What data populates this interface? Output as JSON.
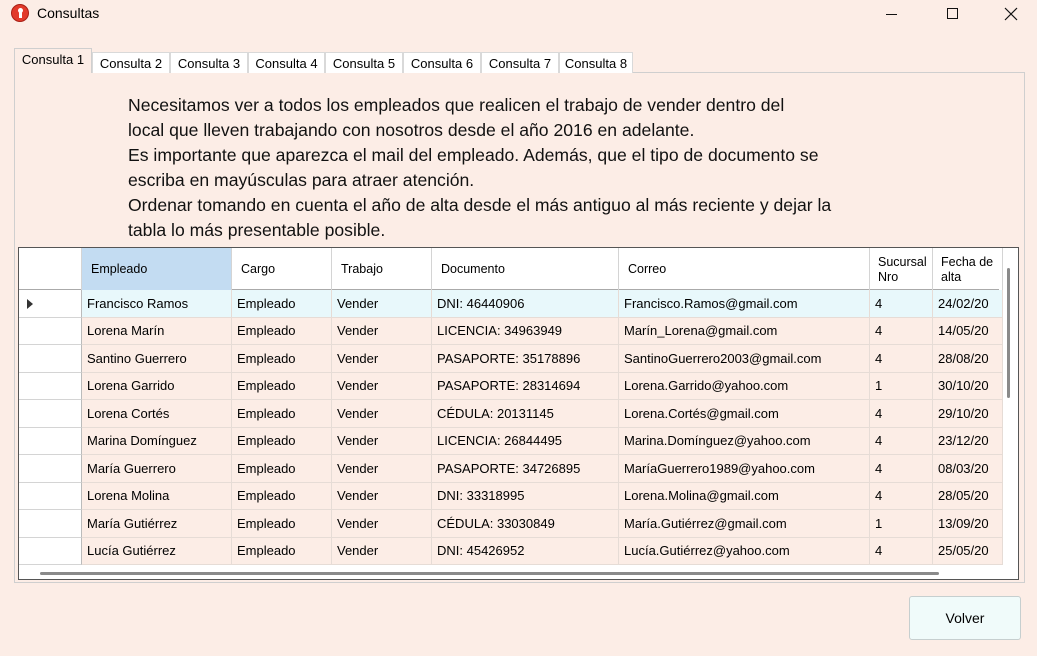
{
  "window": {
    "title": "Consultas",
    "icon": "app-record-icon"
  },
  "tabs": [
    "Consulta 1",
    "Consulta 2",
    "Consulta 3",
    "Consulta 4",
    "Consulta 5",
    "Consulta 6",
    "Consulta 7",
    "Consulta 8"
  ],
  "active_tab": "Consulta 1",
  "description": [
    "Necesitamos ver a todos los empleados que realicen el trabajo de vender dentro del",
    "local que lleven trabajando con nosotros desde el año 2016 en adelante.",
    "Es importante que aparezca el mail del empleado. Además, que el tipo de documento se",
    "escriba en mayúsculas para atraer atención.",
    "Ordenar tomando en cuenta el año de alta desde el más antiguo al más reciente y dejar la",
    "tabla lo más presentable posible."
  ],
  "table": {
    "columns": [
      "Empleado",
      "Cargo",
      "Trabajo",
      "Documento",
      "Correo",
      "Sucursal Nro",
      "Fecha de alta"
    ],
    "rows": [
      [
        "Francisco Ramos",
        "Empleado",
        "Vender",
        "DNI:  46440906",
        "Francisco.Ramos@gmail.com",
        "4",
        "24/02/20"
      ],
      [
        "Lorena Marín",
        "Empleado",
        "Vender",
        "LICENCIA:  34963949",
        "Marín_Lorena@gmail.com",
        "4",
        "14/05/20"
      ],
      [
        "Santino Guerrero",
        "Empleado",
        "Vender",
        "PASAPORTE:  35178896",
        "SantinoGuerrero2003@gmail.com",
        "4",
        "28/08/20"
      ],
      [
        "Lorena Garrido",
        "Empleado",
        "Vender",
        "PASAPORTE:  28314694",
        "Lorena.Garrido@yahoo.com",
        "1",
        "30/10/20"
      ],
      [
        "Lorena Cortés",
        "Empleado",
        "Vender",
        "CÉDULA:  20131145",
        "Lorena.Cortés@gmail.com",
        "4",
        "29/10/20"
      ],
      [
        "Marina Domínguez",
        "Empleado",
        "Vender",
        "LICENCIA:  26844495",
        "Marina.Domínguez@yahoo.com",
        "4",
        "23/12/20"
      ],
      [
        "María Guerrero",
        "Empleado",
        "Vender",
        "PASAPORTE:  34726895",
        "MaríaGuerrero1989@yahoo.com",
        "4",
        "08/03/20"
      ],
      [
        "Lorena Molina",
        "Empleado",
        "Vender",
        "DNI:  33318995",
        "Lorena.Molina@gmail.com",
        "4",
        "28/05/20"
      ],
      [
        "María Gutiérrez",
        "Empleado",
        "Vender",
        "CÉDULA:  33030849",
        "María.Gutiérrez@gmail.com",
        "1",
        "13/09/20"
      ],
      [
        "Lucía Gutiérrez",
        "Empleado",
        "Vender",
        "DNI:  45426952",
        "Lucía.Gutiérrez@yahoo.com",
        "4",
        "25/05/20"
      ]
    ],
    "selected_row": 0
  },
  "buttons": {
    "volver": "Volver"
  },
  "colors": {
    "background": "#fcede6",
    "selected_header": "#c3dcf2",
    "selected_row": "#e8f8fb"
  }
}
